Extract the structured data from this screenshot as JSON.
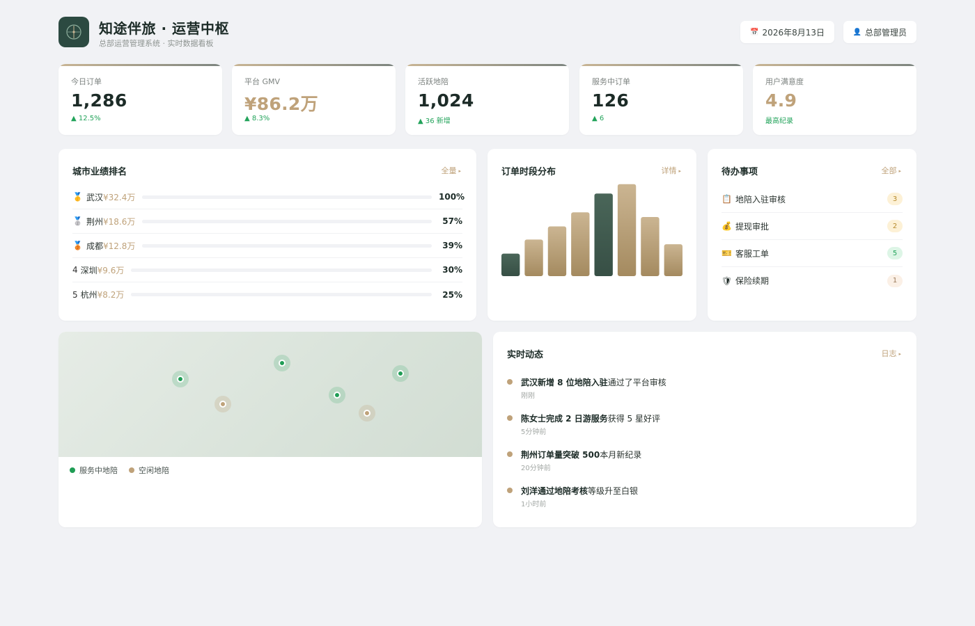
{
  "header": {
    "title": "知途伴旅 · 运营中枢",
    "subtitle": "总部运营管理系统 · 实时数据看板",
    "date": "2026年8月13日",
    "user": "总部管理员"
  },
  "stats": [
    {
      "label": "今日订单",
      "value": "1,286",
      "delta": "▲ 12.5%"
    },
    {
      "label": "平台 GMV",
      "value": "¥86.2万",
      "delta": "▲ 8.3%"
    },
    {
      "label": "活跃地陪",
      "value": "1,024",
      "delta": "▲ 36 新增"
    },
    {
      "label": "服务中订单",
      "value": "126",
      "delta": "▲ 6"
    },
    {
      "label": "用户满意度",
      "value": "4.9",
      "delta": "最高纪录"
    }
  ],
  "ranking": {
    "title": "城市业绩排名",
    "link": "全量",
    "rows": [
      {
        "medal": "🥇",
        "num": "",
        "city": "武汉",
        "amount": "¥32.4万",
        "pct_label": "100%",
        "pct": 1.0
      },
      {
        "medal": "🥈",
        "num": "",
        "city": "荆州",
        "amount": "¥18.6万",
        "pct_label": "57%",
        "pct": 0.57
      },
      {
        "medal": "🥉",
        "num": "",
        "city": "成都",
        "amount": "¥12.8万",
        "pct_label": "39%",
        "pct": 0.39
      },
      {
        "medal": "",
        "num": "4",
        "city": "深圳",
        "amount": "¥9.6万",
        "pct_label": "30%",
        "pct": 0.3
      },
      {
        "medal": "",
        "num": "5",
        "city": "杭州",
        "amount": "¥8.2万",
        "pct_label": "25%",
        "pct": 0.25
      }
    ]
  },
  "distribution": {
    "title": "订单时段分布",
    "link": "详情"
  },
  "chart_data": {
    "type": "bar",
    "values": [
      24,
      39,
      53,
      68,
      88,
      98,
      63,
      34
    ],
    "highlight": [
      true,
      false,
      false,
      false,
      true,
      false,
      false,
      false
    ],
    "ylim": [
      0,
      100
    ],
    "colors": {
      "highlight": "#3f5a50",
      "normal": "#bfa27a"
    }
  },
  "todo": {
    "title": "待办事项",
    "link": "全部",
    "items": [
      {
        "icon": "📋",
        "label": "地陪入驻审核",
        "count": "3",
        "bg": "#fdf1d6",
        "fg": "#b58a2c"
      },
      {
        "icon": "💰",
        "label": "提现审批",
        "count": "2",
        "bg": "#fdf1d6",
        "fg": "#b58a2c"
      },
      {
        "icon": "🎫",
        "label": "客服工单",
        "count": "5",
        "bg": "#ddf5e6",
        "fg": "#22a35a"
      },
      {
        "icon": "🛡",
        "label": "保险续期",
        "count": "1",
        "bg": "#fbf0e6",
        "fg": "#9a7a5a"
      }
    ]
  },
  "map": {
    "legend_serving": "服务中地陪",
    "legend_idle": "空闲地陪",
    "color_serving": "#1f9d55",
    "color_idle": "#bfa27a"
  },
  "feed": {
    "title": "实时动态",
    "link": "日志",
    "items": [
      {
        "bold": "武汉新增 8 位地陪入驻",
        "rest": "通过了平台审核",
        "time": "刚刚"
      },
      {
        "bold": "陈女士完成 2 日游服务",
        "rest": "获得 5 星好评",
        "time": "5分钟前"
      },
      {
        "bold": "荆州订单量突破 500",
        "rest": "本月新纪录",
        "time": "20分钟前"
      },
      {
        "bold": "刘洋通过地陪考核",
        "rest": "等级升至白银",
        "time": "1小时前"
      }
    ]
  }
}
